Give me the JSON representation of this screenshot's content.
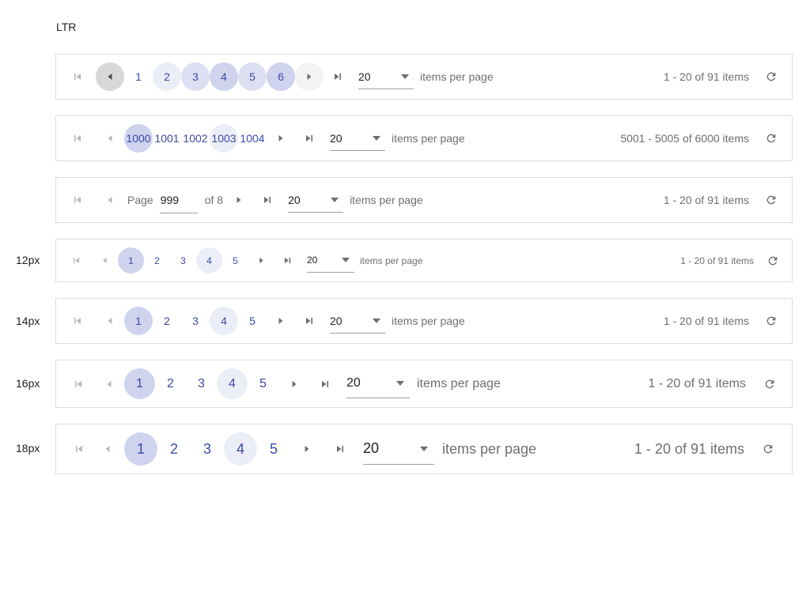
{
  "heading": "LTR",
  "size_labels": {
    "s12": "12px",
    "s14": "14px",
    "s16": "16px",
    "s18": "18px"
  },
  "icons": {
    "first": "first-page-icon",
    "prev": "prev-arrow-icon",
    "next": "next-arrow-icon",
    "last": "last-page-icon",
    "refresh": "refresh-icon",
    "dropdown": "chevron-down-icon"
  },
  "colors": {
    "page_link": "#3a4aa8",
    "border": "#dcdcdc",
    "muted_text": "#6f6f6f"
  },
  "row1": {
    "pages": [
      "1",
      "2",
      "3",
      "4",
      "5",
      "6"
    ],
    "page_size": "20",
    "items_per_page": "items per page",
    "info": "1 - 20 of 91 items"
  },
  "row2": {
    "pages": [
      "1000",
      "1001",
      "1002",
      "1003",
      "1004"
    ],
    "page_size": "20",
    "items_per_page": "items per page",
    "info": "5001 - 5005 of 6000 items"
  },
  "row3": {
    "page_label": "Page",
    "page_value": "999",
    "of_label": "of 8",
    "page_size": "20",
    "items_per_page": "items per page",
    "info": "1 - 20 of 91 items"
  },
  "row4": {
    "pages": [
      "1",
      "2",
      "3",
      "4",
      "5"
    ],
    "page_size": "20",
    "items_per_page": "items per page",
    "info": "1 - 20 of 91 items"
  },
  "row5": {
    "pages": [
      "1",
      "2",
      "3",
      "4",
      "5"
    ],
    "page_size": "20",
    "items_per_page": "items per page",
    "info": "1 - 20 of 91 items"
  },
  "row6": {
    "pages": [
      "1",
      "2",
      "3",
      "4",
      "5"
    ],
    "page_size": "20",
    "items_per_page": "items per page",
    "info": "1 - 20 of 91 items"
  },
  "row7": {
    "pages": [
      "1",
      "2",
      "3",
      "4",
      "5"
    ],
    "page_size": "20",
    "items_per_page": "items per page",
    "info": "1 - 20 of 91 items"
  }
}
